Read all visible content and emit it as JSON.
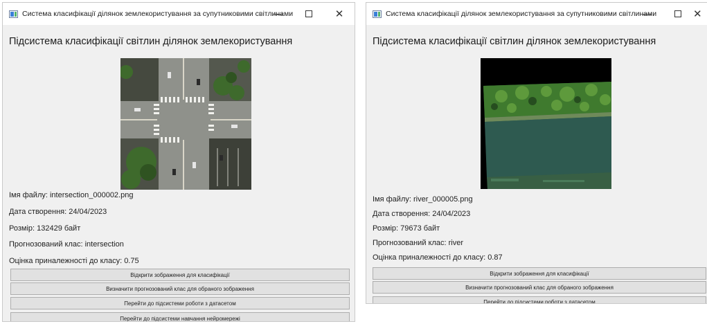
{
  "windows": [
    {
      "title": "Система класифікації ділянок землекористування за супутниковими світлинами",
      "heading": "Підсистема класифікації світлин ділянок землекористування",
      "image_subject": "intersection",
      "info": {
        "file_name": "Імя файлу: intersection_000002.png",
        "created": "Дата створення: 24/04/2023",
        "size": "Розмір: 132429 байт",
        "predicted_class": "Прогнозований клас: intersection",
        "score": "Оцінка приналежності до класу: 0.75"
      },
      "buttons": {
        "open": "Відкрити зображення для класифікації",
        "predict": "Визначити прогнозований клас для обраного зображення",
        "dataset": "Перейти до підсистеми роботи з датасетом",
        "training": "Перейти до підсистеми навчання нейромережі"
      }
    },
    {
      "title": "Система класифікації ділянок землекористування за супутниковими світлинами",
      "heading": "Підсистема класифікації світлин ділянок землекористування",
      "image_subject": "river",
      "info": {
        "file_name": "Імя файлу: river_000005.png",
        "created": "Дата створення: 24/04/2023",
        "size": "Розмір: 79673 байт",
        "predicted_class": "Прогнозований клас: river",
        "score": "Оцінка приналежності до класу: 0.87"
      },
      "buttons": {
        "open": "Відкрити зображення для класифікації",
        "predict": "Визначити прогнозований клас для обраного зображення",
        "dataset": "Перейти до підсистеми роботи з датасетом"
      }
    }
  ],
  "window_controls": {
    "minimize": "—",
    "close": "✕"
  },
  "colors": {
    "window_bg": "#f0f0f0",
    "titlebar_bg": "#ffffff",
    "button_bg": "#e1e1e1",
    "button_border": "#adadad"
  }
}
